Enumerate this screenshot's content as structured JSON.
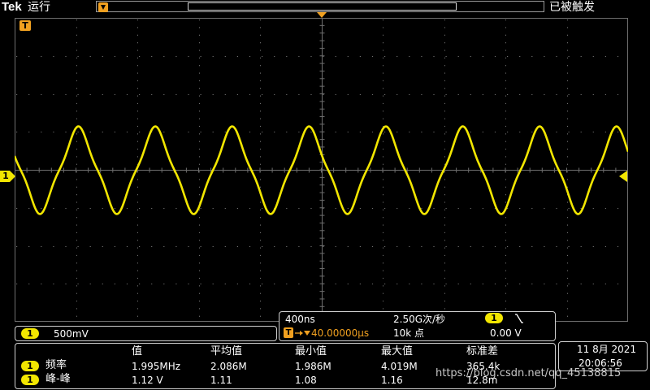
{
  "header": {
    "brand": "Tek",
    "run_state": "运行",
    "trigger_status": "已被触发"
  },
  "markers": {
    "trigger_time_marker": "T",
    "channel_marker": "1"
  },
  "channel1": {
    "label": "1",
    "scale": "500mV",
    "color": "#f2e600"
  },
  "timebase": {
    "horizontal_scale": "400ns",
    "sample_rate": "2.50G次/秒",
    "position_label": "T",
    "position_value": "40.00000µs",
    "record_length": "10k 点"
  },
  "trigger": {
    "source": "1",
    "slope_icon": "falling-edge-icon",
    "level": "0.00 V"
  },
  "measurements": {
    "headers": [
      "值",
      "平均值",
      "最小值",
      "最大值",
      "标准差"
    ],
    "rows": [
      {
        "channel": "1",
        "name": "频率",
        "values": [
          "1.995MHz",
          "2.086M",
          "1.986M",
          "4.019M",
          "365.4k"
        ]
      },
      {
        "channel": "1",
        "name": "峰-峰",
        "values": [
          "1.12 V",
          "1.11",
          "1.08",
          "1.16",
          "12.8m"
        ]
      }
    ]
  },
  "clock": {
    "date": "11 8月 2021",
    "time": "20:06:56"
  },
  "watermark": "https://blog.csdn.net/qq_45138815",
  "waveform": {
    "channel": "1",
    "frequency_mhz": 1.995,
    "peak_to_peak_v": 1.12,
    "volts_per_div": 0.5,
    "time_per_div_ns": 400
  },
  "colors": {
    "trace": "#f2e600",
    "grid": "#6e6e6e",
    "marker": "#f0a020"
  }
}
